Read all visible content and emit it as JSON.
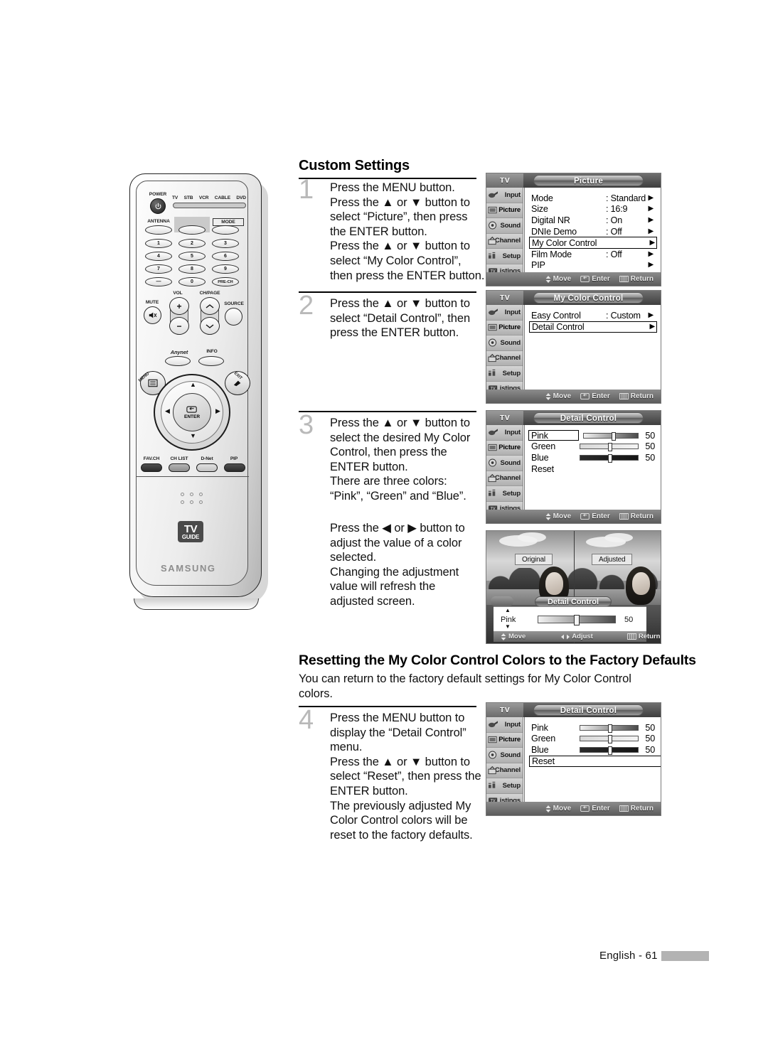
{
  "page": {
    "footer_text": "English - 61"
  },
  "sections": {
    "custom_settings": {
      "heading": "Custom Settings",
      "steps": [
        {
          "number": "1",
          "lines": [
            "Press the MENU button.",
            "Press the ▲ or ▼ button to",
            "select “Picture”, then press",
            "the ENTER button.",
            "Press the ▲ or ▼ button to",
            "select “My Color Control”,",
            "then press the ENTER button."
          ]
        },
        {
          "number": "2",
          "lines": [
            "Press the ▲ or ▼ button to",
            "select “Detail Control”, then",
            "press the ENTER button."
          ]
        },
        {
          "number": "3",
          "lines": [
            "Press the ▲ or ▼ button to",
            "select the desired My Color",
            "Control, then press the",
            "ENTER button.",
            "There are three colors:",
            "“Pink”, “Green” and “Blue”."
          ]
        }
      ],
      "note_lines": [
        "Press the ◀ or ▶ button to",
        "adjust the value of a color",
        "selected.",
        "Changing the adjustment",
        "value will refresh the",
        "adjusted screen."
      ]
    },
    "resetting": {
      "heading": "Resetting the My Color Control Colors to the Factory Defaults",
      "intro_lines": [
        "You can return to the factory default settings for My Color Control",
        "colors."
      ],
      "steps": [
        {
          "number": "4",
          "lines": [
            "Press the MENU button to",
            "display the “Detail Control”",
            "menu.",
            "Press the ▲ or ▼ button to",
            "select “Reset”, then press the",
            "ENTER button.",
            "The previously adjusted My",
            "Color Control colors will be",
            "reset to the factory defaults."
          ]
        }
      ]
    }
  },
  "osd_common": {
    "tv_label": "TV",
    "sidebar": [
      {
        "label": "Input",
        "icon": "input-icon",
        "active": false
      },
      {
        "label": "Picture",
        "icon": "picture-icon",
        "active": true
      },
      {
        "label": "Sound",
        "icon": "sound-icon",
        "active": false
      },
      {
        "label": "Channel",
        "icon": "channel-icon",
        "active": false
      },
      {
        "label": "Setup",
        "icon": "setup-icon",
        "active": false
      },
      {
        "label": "Listings",
        "icon": "listings-icon",
        "active": false
      }
    ],
    "hints": [
      {
        "icon": "updown-icon",
        "label": "Move"
      },
      {
        "icon": "enter-icon",
        "label": "Enter"
      },
      {
        "icon": "return-icon",
        "label": "Return"
      }
    ]
  },
  "osd_picture": {
    "title": "Picture",
    "rows": [
      {
        "label": "Mode",
        "value": ": Standard",
        "arrow": "▶",
        "selected": false
      },
      {
        "label": "Size",
        "value": ": 16:9",
        "arrow": "▶",
        "selected": false
      },
      {
        "label": "Digital NR",
        "value": ": On",
        "arrow": "▶",
        "selected": false
      },
      {
        "label": "DNIe Demo",
        "value": ": Off",
        "arrow": "▶",
        "selected": false
      },
      {
        "label": "My Color Control",
        "value": "",
        "arrow": "▶",
        "selected": true
      },
      {
        "label": "Film Mode",
        "value": ": Off",
        "arrow": "▶",
        "selected": false
      },
      {
        "label": "PIP",
        "value": "",
        "arrow": "▶",
        "selected": false
      }
    ]
  },
  "osd_mycolor": {
    "title": "My Color Control",
    "rows": [
      {
        "label": "Easy Control",
        "value": ": Custom",
        "arrow": "▶",
        "selected": false
      },
      {
        "label": "Detail Control",
        "value": "",
        "arrow": "▶",
        "selected": true
      }
    ]
  },
  "osd_detail": {
    "title": "Detail Control",
    "sliders": [
      {
        "name": "Pink",
        "value": "50",
        "percent": 50,
        "selected": true
      },
      {
        "name": "Green",
        "value": "50",
        "percent": 50,
        "selected": false
      },
      {
        "name": "Blue",
        "value": "50",
        "percent": 50,
        "selected": false
      }
    ],
    "reset_label": "Reset",
    "reset_selected": false
  },
  "osd_detail_reset": {
    "title": "Detail Control",
    "sliders": [
      {
        "name": "Pink",
        "value": "50",
        "percent": 50,
        "selected": false
      },
      {
        "name": "Green",
        "value": "50",
        "percent": 50,
        "selected": false
      },
      {
        "name": "Blue",
        "value": "50",
        "percent": 50,
        "selected": false
      }
    ],
    "reset_label": "Reset",
    "reset_selected": true
  },
  "osd_preview": {
    "label_original": "Original",
    "label_adjusted": "Adjusted",
    "overlay_title": "Detail Control",
    "slider_name": "Pink",
    "slider_value": "50",
    "up_arrow": "▲",
    "down_arrow": "▼",
    "hints": [
      {
        "icon": "updown-icon",
        "label": "Move"
      },
      {
        "icon": "leftright-icon",
        "label": "Adjust"
      },
      {
        "icon": "return-icon",
        "label": "Return"
      }
    ]
  },
  "remote": {
    "power_label": "POWER",
    "device_labels": [
      "TV",
      "STB",
      "VCR",
      "CABLE",
      "DVD"
    ],
    "row1": [
      {
        "label": "ANTENNA",
        "text": ""
      },
      {
        "label": "TV Guide",
        "text": ""
      },
      {
        "label": "MODE",
        "text": ""
      }
    ],
    "keypad": [
      "1",
      "2",
      "3",
      "4",
      "5",
      "6",
      "7",
      "8",
      "9",
      "—",
      "0",
      "PRE-CH"
    ],
    "vol_label": "VOL",
    "chpage_label": "CH/PAGE",
    "mute_label": "MUTE",
    "source_label": "SOURCE",
    "anynet_label": "Anynet",
    "info_label": "INFO",
    "menu_label": "MENU",
    "exit_label": "EXIT",
    "enter_label": "ENTER",
    "bottom_buttons": [
      "FAV.CH",
      "CH LIST",
      "D-Net",
      "PIP"
    ],
    "tvguide_line1": "TV",
    "tvguide_line2": "GUIDE",
    "brand": "SAMSUNG"
  }
}
